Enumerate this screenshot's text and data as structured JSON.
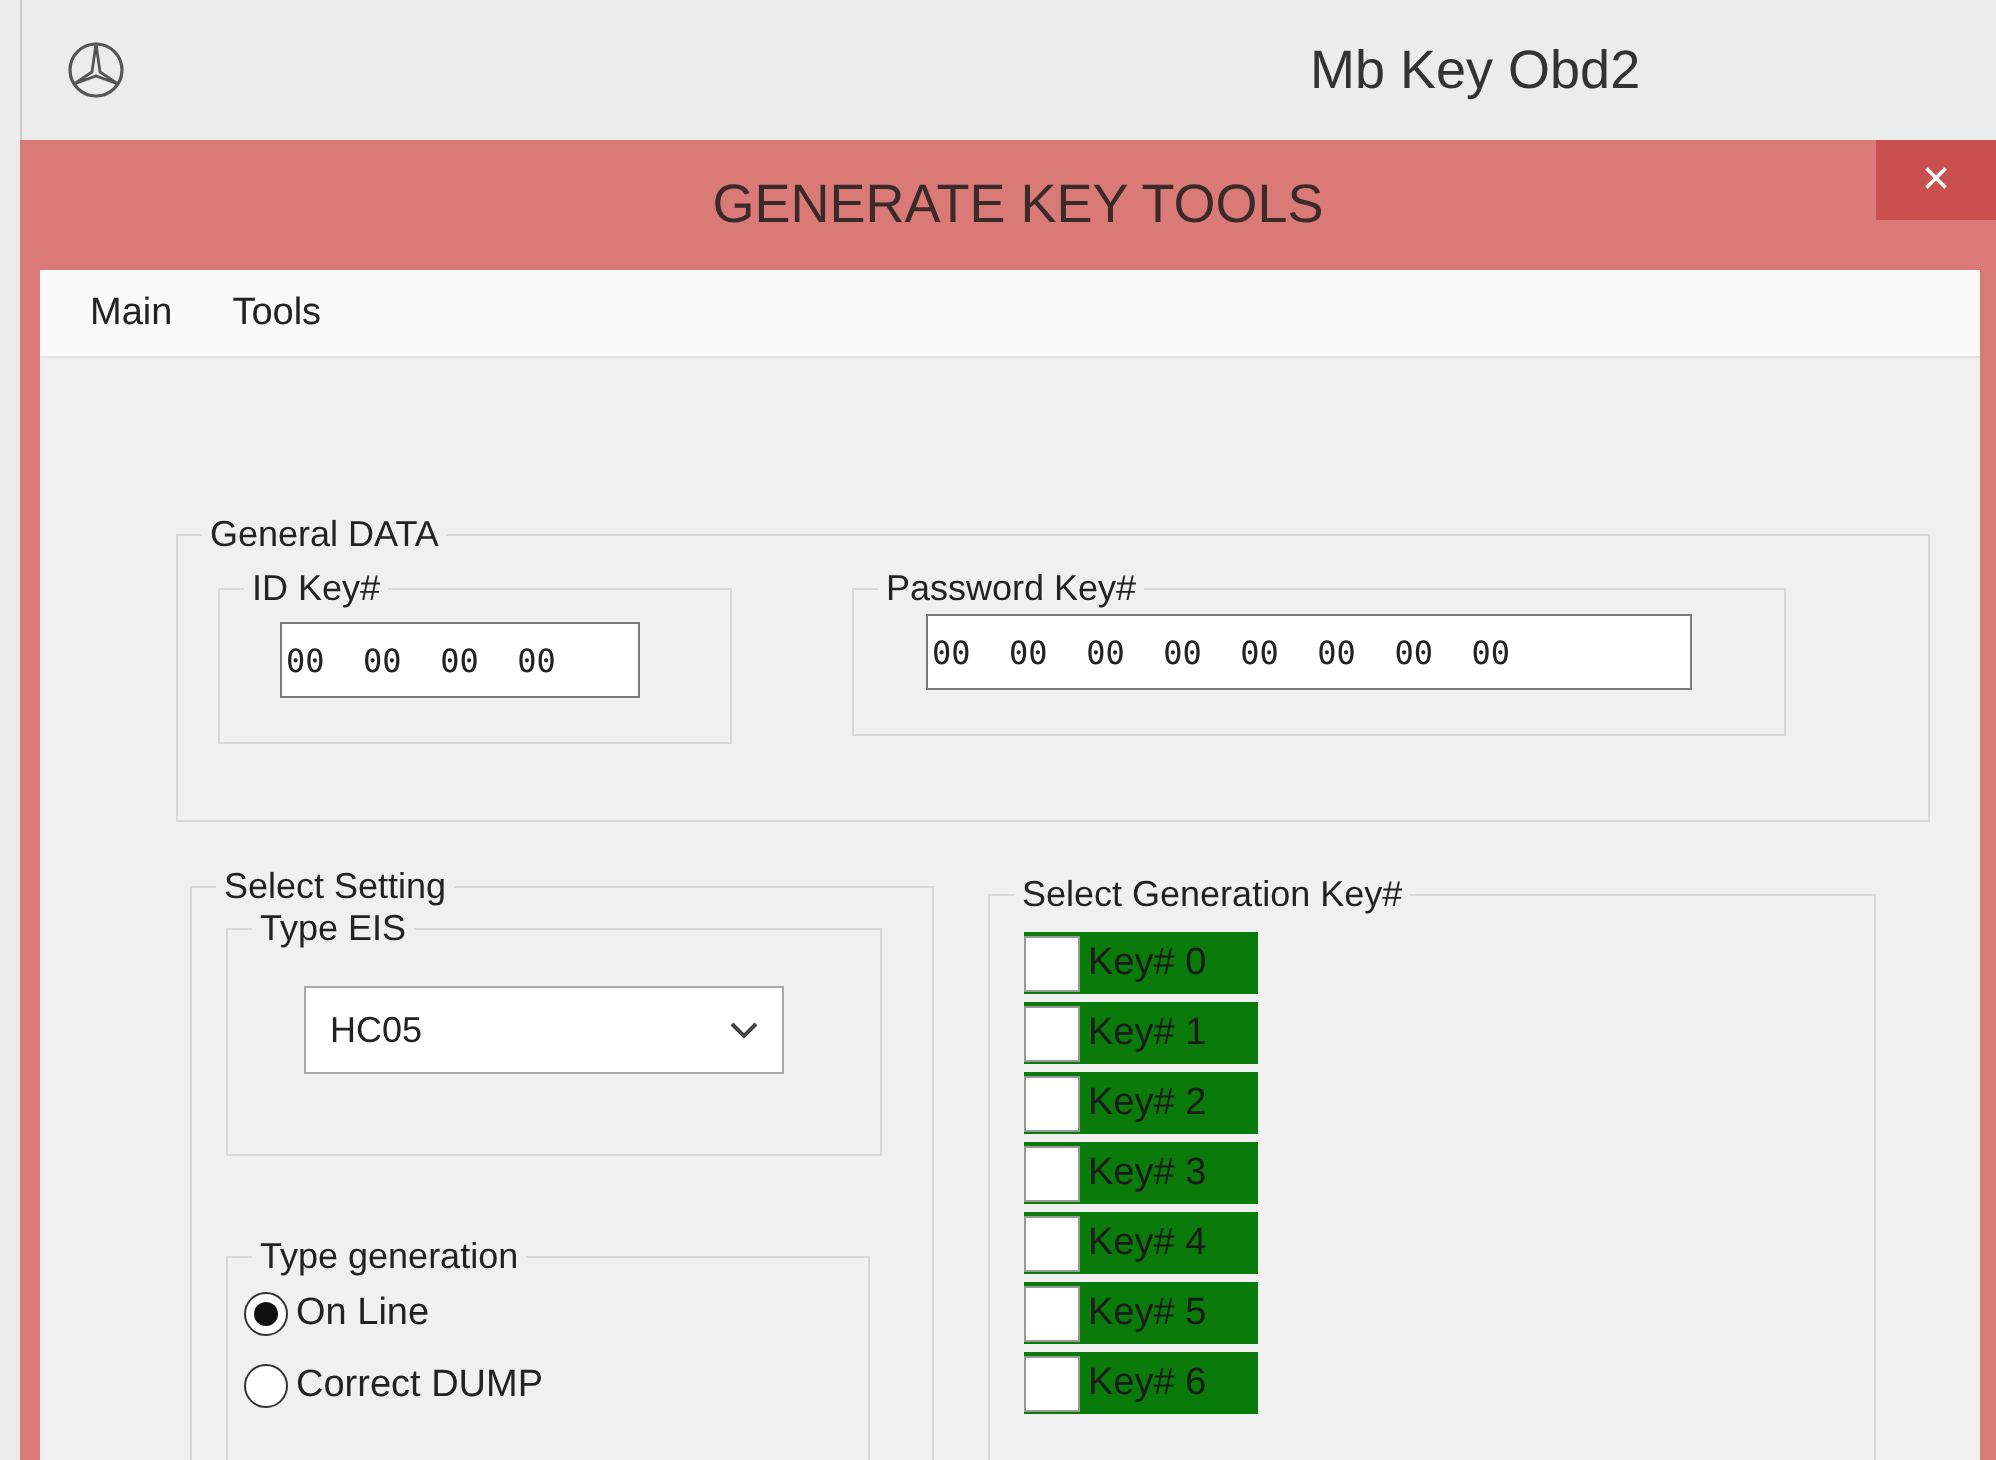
{
  "app_title": "Mb Key Obd2",
  "dialog_title": "GENERATE KEY TOOLS",
  "close_button": "×",
  "menu": [
    "Main",
    "Tools"
  ],
  "general_data": {
    "legend": "General DATA",
    "id_key": {
      "legend": "ID Key#",
      "value": "00  00  00  00"
    },
    "password_key": {
      "legend": "Password Key#",
      "value": "00  00  00  00  00  00  00  00"
    }
  },
  "select_setting": {
    "legend": "Select Setting",
    "type_eis": {
      "legend": "Type EIS",
      "value": "HC05"
    },
    "type_generation": {
      "legend": "Type generation",
      "options": [
        {
          "label": "On Line",
          "selected": true
        },
        {
          "label": "Correct DUMP",
          "selected": false
        }
      ]
    }
  },
  "generation_keys": {
    "legend": "Select Generation Key#",
    "keys": [
      {
        "label": "Key# 0",
        "checked": false
      },
      {
        "label": "Key# 1",
        "checked": false
      },
      {
        "label": "Key# 2",
        "checked": false
      },
      {
        "label": "Key# 3",
        "checked": false
      },
      {
        "label": "Key# 4",
        "checked": false
      },
      {
        "label": "Key# 5",
        "checked": false
      },
      {
        "label": "Key# 6",
        "checked": false
      }
    ]
  }
}
